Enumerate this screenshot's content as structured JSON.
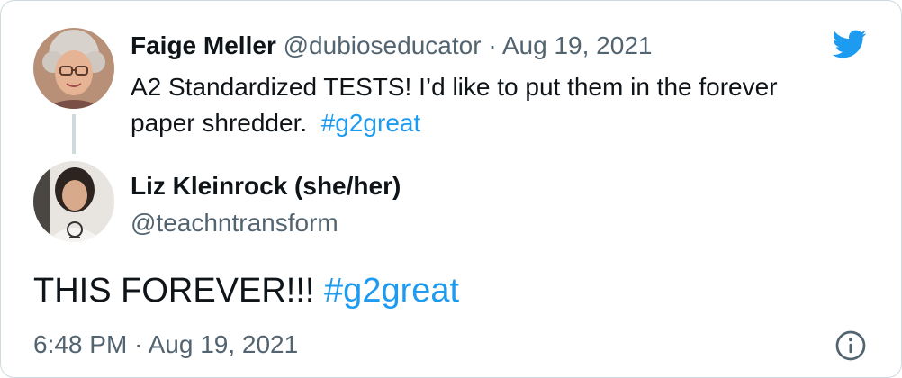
{
  "colors": {
    "link": "#1d9bf0",
    "muted_text": "#536471",
    "primary_text": "#0f1419",
    "border": "#cfd9de"
  },
  "icons": {
    "brand": "twitter-bird-icon",
    "info": "info-circle-icon"
  },
  "quoted_tweet": {
    "author_name": "Faige Meller",
    "author_handle": "@dubioseducator",
    "separator": "·",
    "date": "Aug 19, 2021",
    "text": "A2 Standardized TESTS! I’d like to put them in the forever paper shredder.",
    "hashtag": "#g2great"
  },
  "reply": {
    "author_name": "Liz Kleinrock (she/her)",
    "author_handle": "@teachntransform"
  },
  "main_tweet": {
    "text": "THIS FOREVER!!!",
    "hashtag": "#g2great",
    "timestamp": "6:48 PM · Aug 19, 2021"
  }
}
